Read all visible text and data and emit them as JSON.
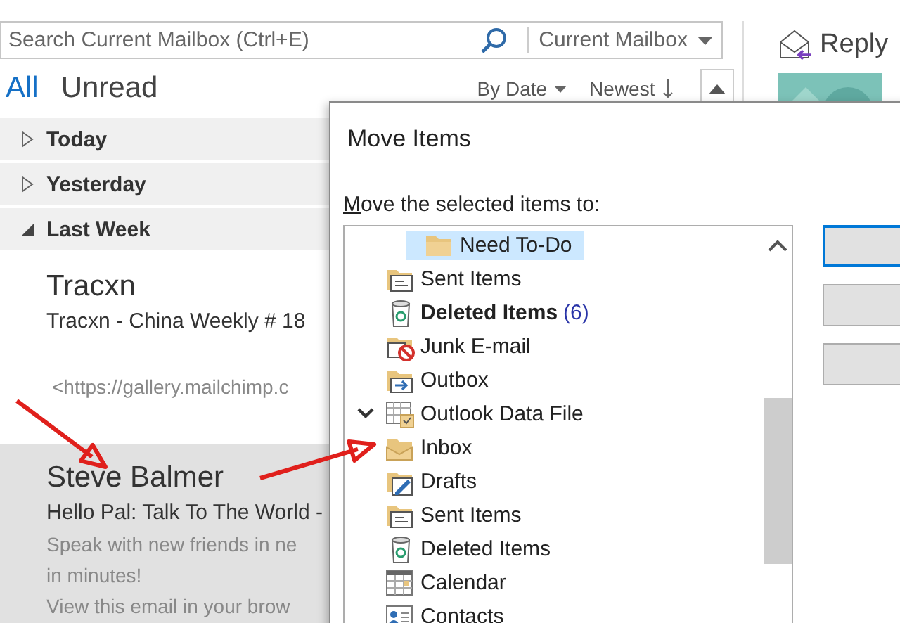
{
  "search": {
    "placeholder": "Search Current Mailbox (Ctrl+E)",
    "scope": "Current Mailbox"
  },
  "filters": [
    {
      "label": "All",
      "selected": true
    },
    {
      "label": "Unread",
      "selected": false
    }
  ],
  "sort": {
    "by": "By Date",
    "order": "Newest"
  },
  "groups": [
    {
      "label": "Today",
      "expanded": false
    },
    {
      "label": "Yesterday",
      "expanded": false
    },
    {
      "label": "Last Week",
      "expanded": true,
      "messages": [
        {
          "sender": "Tracxn",
          "subject": "Tracxn - China Weekly # 18",
          "preview": [
            "<https://gallery.mailchimp.c"
          ],
          "selected": false
        },
        {
          "sender": "Steve Balmer",
          "subject": "Hello Pal: Talk To The World -",
          "preview": [
            "Speak with new friends in ne",
            "in minutes!",
            "View this email in your brow"
          ],
          "selected": true
        }
      ]
    }
  ],
  "reading_pane": {
    "reply": "Reply"
  },
  "dialog": {
    "title": "Move Items",
    "label": "Move the selected items to:",
    "tree": [
      {
        "children": [
          {
            "children": [
              {
                "label": "Need To-Do",
                "kind": "folder",
                "selected": true
              }
            ]
          },
          {
            "label": "Sent Items",
            "kind": "sent",
            "selected": false
          },
          {
            "label": "Deleted Items",
            "kind": "trash",
            "selected": false,
            "bold": true,
            "count": "(6)"
          },
          {
            "label": "Junk E-mail",
            "kind": "junk",
            "selected": false
          },
          {
            "label": "Outbox",
            "kind": "outbox",
            "selected": false
          }
        ]
      },
      {
        "label": "Outlook Data File",
        "kind": "datafile",
        "selected": false,
        "expanded": true,
        "children": [
          {
            "label": "Inbox",
            "kind": "inbox",
            "selected": false
          },
          {
            "label": "Drafts",
            "kind": "drafts",
            "selected": false
          },
          {
            "label": "Sent Items",
            "kind": "sent",
            "selected": false
          },
          {
            "label": "Deleted Items",
            "kind": "trash",
            "selected": false
          },
          {
            "label": "Calendar",
            "kind": "calendar",
            "selected": false
          },
          {
            "label": "Contacts",
            "kind": "contacts",
            "selected": false
          }
        ]
      }
    ],
    "buttons": [
      {
        "default": true
      },
      {
        "default": false
      },
      {
        "default": false
      }
    ]
  },
  "annotations": [
    {
      "kind": "arrow"
    },
    {
      "kind": "arrow"
    }
  ]
}
